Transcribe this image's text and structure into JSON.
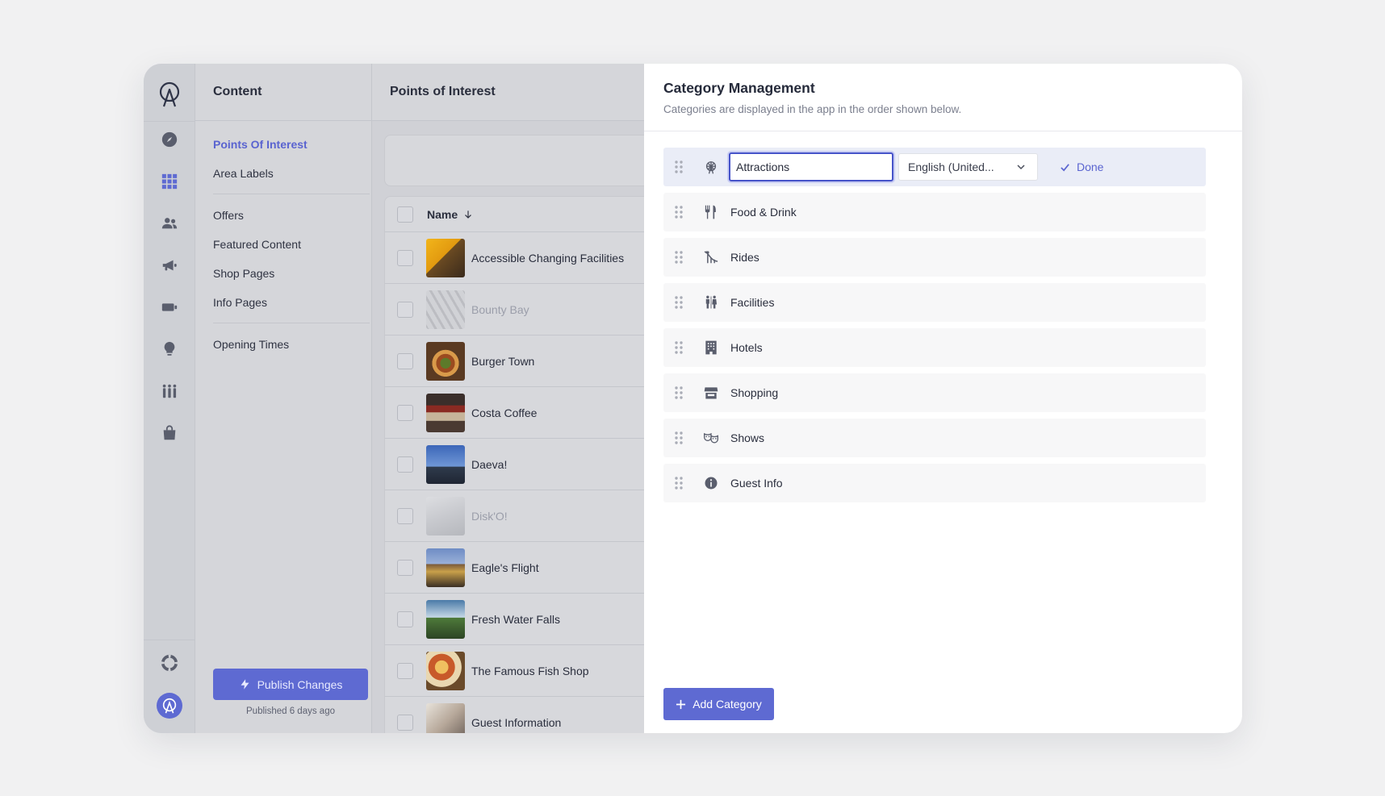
{
  "rail": {
    "icons": [
      "app-logo-icon",
      "compass-icon",
      "grid-icon",
      "users-icon",
      "megaphone-icon",
      "ticket-icon",
      "lightbulb-icon",
      "queue-icon",
      "shopping-bag-icon",
      "lifebuoy-icon",
      "account-avatar-icon"
    ],
    "active": "grid-icon"
  },
  "content_sidebar": {
    "title": "Content",
    "groups": [
      [
        "Points Of Interest",
        "Area Labels"
      ],
      [
        "Offers",
        "Featured Content",
        "Shop Pages",
        "Info Pages"
      ],
      [
        "Opening Times"
      ]
    ],
    "active_item": "Points Of Interest",
    "publish_label": "Publish Changes",
    "published_note": "Published 6 days ago"
  },
  "poi": {
    "title": "Points of Interest",
    "column_name": "Name",
    "rows": [
      {
        "name": "Accessible Changing Facilities",
        "dim": false
      },
      {
        "name": "Bounty Bay",
        "dim": true
      },
      {
        "name": "Burger Town",
        "dim": false
      },
      {
        "name": "Costa Coffee",
        "dim": false
      },
      {
        "name": "Daeva!",
        "dim": false
      },
      {
        "name": "Disk'O!",
        "dim": true
      },
      {
        "name": "Eagle's Flight",
        "dim": false
      },
      {
        "name": "Fresh Water Falls",
        "dim": false
      },
      {
        "name": "The Famous Fish Shop",
        "dim": false
      },
      {
        "name": "Guest Information",
        "dim": false
      }
    ]
  },
  "panel": {
    "title": "Category Management",
    "subtitle": "Categories are displayed in the app in the order shown below.",
    "editing": {
      "icon": "ferris-wheel-icon",
      "value": "Attractions",
      "language": "English (United...",
      "done_label": "Done"
    },
    "categories": [
      {
        "label": "Food & Drink",
        "icon": "cutlery-icon"
      },
      {
        "label": "Rides",
        "icon": "rollercoaster-icon"
      },
      {
        "label": "Facilities",
        "icon": "restroom-icon"
      },
      {
        "label": "Hotels",
        "icon": "building-icon"
      },
      {
        "label": "Shopping",
        "icon": "storefront-icon"
      },
      {
        "label": "Shows",
        "icon": "theater-masks-icon"
      },
      {
        "label": "Guest Info",
        "icon": "info-icon"
      }
    ],
    "add_label": "Add Category"
  },
  "colors": {
    "accent": "#5e6ad2",
    "overlay": "#d5d6da",
    "panel_bg": "#ffffff",
    "editing_row": "#eaedf7"
  }
}
